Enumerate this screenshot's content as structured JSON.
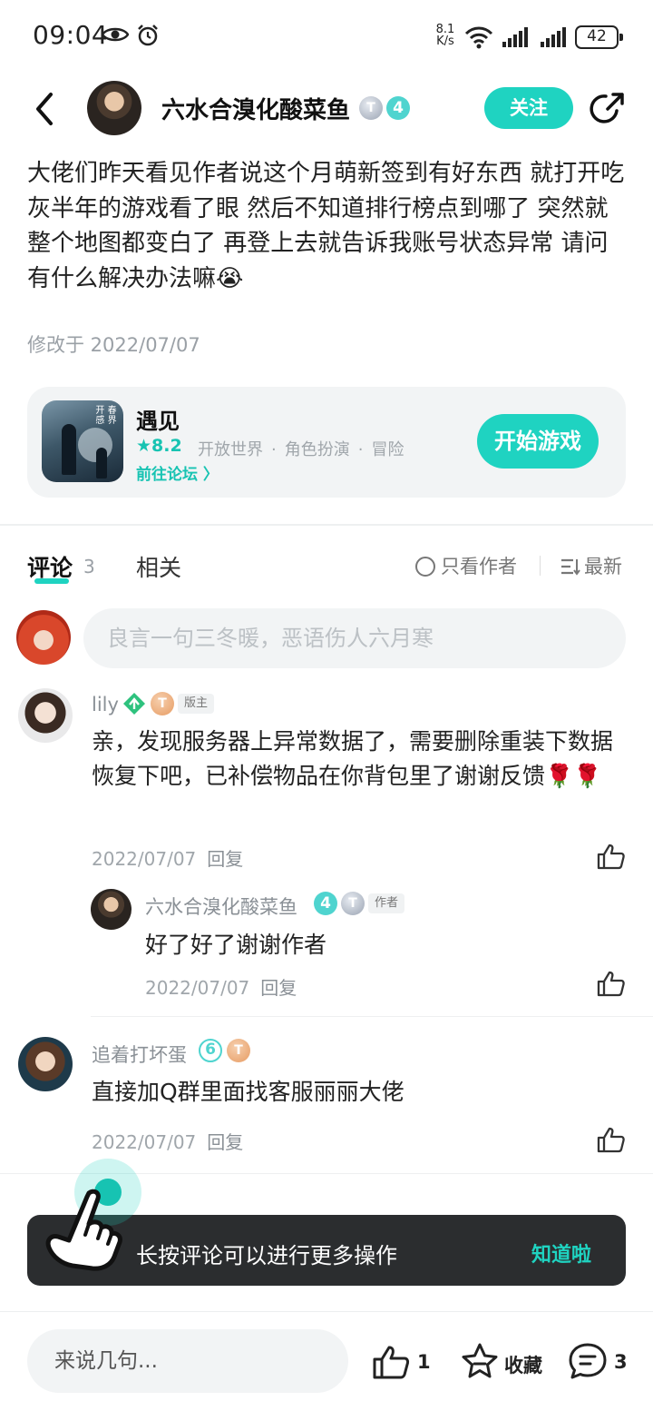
{
  "status_bar": {
    "time": "09:04",
    "net_speed_value": "8.1",
    "net_speed_unit": "K/s",
    "battery": "42"
  },
  "header": {
    "author_name": "六水合溴化酸菜鱼",
    "author_badge_t": "T",
    "author_level": "4",
    "follow_label": "关注"
  },
  "post": {
    "body": "大佬们昨天看见作者说这个月萌新签到有好东西 就打开吃灰半年的游戏看了眼 然后不知道排行榜点到哪了 突然就整个地图都变白了 再登上去就告诉我账号状态异常 请问有什么解决办法嘛😭",
    "modified": "修改于 2022/07/07"
  },
  "game_card": {
    "title": "遇见",
    "rating": "★8.2",
    "tags": [
      "开放世界",
      "角色扮演",
      "冒险"
    ],
    "forum_link": "前往论坛 〉",
    "play_label": "开始游戏",
    "icon_mark": "开 春 感 界"
  },
  "tabs": {
    "comments_label": "评论",
    "comments_count": "3",
    "related_label": "相关",
    "only_author_label": "只看作者",
    "sort_label": "最新"
  },
  "composer": {
    "placeholder": "良言一句三冬暖，恶语伤人六月寒"
  },
  "comments": [
    {
      "name": "lily",
      "badge_t": "T",
      "role": "版主",
      "text": "亲，发现服务器上异常数据了，需要删除重装下数据恢复下吧，已补偿物品在你背包里了谢谢反馈🌹🌹",
      "date": "2022/07/07",
      "reply_label": "回复",
      "reply": {
        "name": "六水合溴化酸菜鱼",
        "level": "4",
        "badge_t": "T",
        "role": "作者",
        "text": "好了好了谢谢作者",
        "date": "2022/07/07",
        "reply_label": "回复"
      }
    },
    {
      "name": "追着打坏蛋",
      "level": "6",
      "badge_t": "T",
      "text": "直接加Q群里面找客服丽丽大佬",
      "date": "2022/07/07",
      "reply_label": "回复"
    }
  ],
  "toast": {
    "text": "长按评论可以进行更多操作",
    "action": "知道啦"
  },
  "bottom_bar": {
    "input_placeholder": "来说几句...",
    "like_count": "1",
    "favorite_label": "收藏",
    "comment_count": "3"
  },
  "colors": {
    "accent": "#1fd3c1",
    "toast_bg": "#2b2d2f",
    "card_bg": "#f2f4f5"
  },
  "icons": [
    "eye-icon",
    "alarm-icon",
    "wifi-icon",
    "signal-icon",
    "battery-icon",
    "back-icon",
    "share-icon",
    "star-icon",
    "radio-icon",
    "sort-icon",
    "like-icon",
    "favorite-icon",
    "comment-icon",
    "hand-pointer-icon"
  ]
}
